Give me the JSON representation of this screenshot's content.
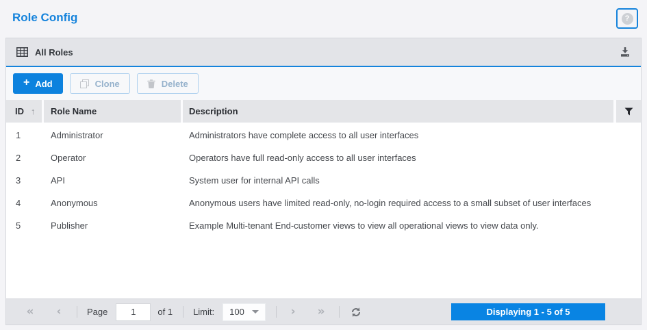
{
  "page": {
    "title": "Role Config"
  },
  "colors": {
    "primary_blue": "#0d82de",
    "header_gray": "#e3e4e8",
    "badge_blue": "#0984e3",
    "disabled_button_text": "#96b2cc"
  },
  "icons": {
    "help": "?",
    "plus": "+",
    "sort_asc": "↑",
    "first": "«",
    "prev": "‹",
    "next": "›",
    "last": "»"
  },
  "panel": {
    "header": {
      "title": "All Roles"
    },
    "toolbar": {
      "add_label": "Add",
      "clone_label": "Clone",
      "delete_label": "Delete"
    },
    "table": {
      "columns": [
        "ID",
        "Role Name",
        "Description"
      ],
      "rows": [
        {
          "id": "1",
          "role_name": "Administrator",
          "description": "Administrators have complete access to all user interfaces"
        },
        {
          "id": "2",
          "role_name": "Operator",
          "description": "Operators have full read-only access to all user interfaces"
        },
        {
          "id": "3",
          "role_name": "API",
          "description": "System user for internal API calls"
        },
        {
          "id": "4",
          "role_name": "Anonymous",
          "description": "Anonymous users have limited read-only, no-login required access to a small subset of user interfaces"
        },
        {
          "id": "5",
          "role_name": "Publisher",
          "description": "Example Multi-tenant End-customer views to view all operational views to view data only."
        }
      ]
    },
    "pagination": {
      "page_label": "Page",
      "page_value": "1",
      "of_label": "of 1",
      "limit_label": "Limit:",
      "limit_value": "100",
      "displaying_text": "Displaying 1 - 5 of 5"
    }
  }
}
